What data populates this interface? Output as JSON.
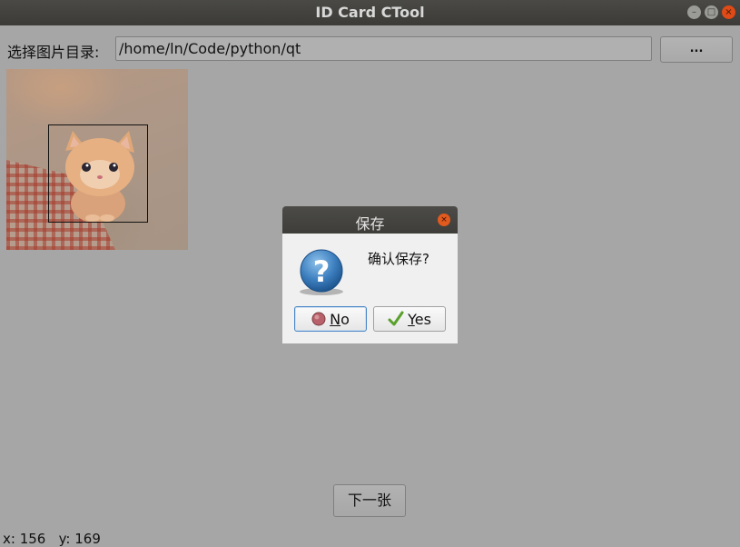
{
  "window": {
    "title": "ID Card CTool",
    "controls": {
      "minimize": "–",
      "maximize": "□",
      "close": "×"
    }
  },
  "directory": {
    "label": "选择图片目录:",
    "path": "/home/ln/Code/python/qt",
    "browse_label": "..."
  },
  "image": {
    "subject": "kitten-photo"
  },
  "dialog": {
    "title": "保存",
    "close": "×",
    "message": "确认保存?",
    "icon": "question-icon",
    "no_label": "No",
    "yes_label": "Yes",
    "no_mnemonic": "N",
    "no_rest": "o",
    "yes_mnemonic": "Y",
    "yes_rest": "es"
  },
  "next_button": "下一张",
  "status": {
    "coords": "x: 156   y: 169"
  },
  "colors": {
    "background": "#a6a6a6",
    "titlebar": "#3c3b37",
    "close_button": "#df4a16",
    "dialog_body": "#f0f0f0",
    "focus_border": "#4a86c5"
  }
}
